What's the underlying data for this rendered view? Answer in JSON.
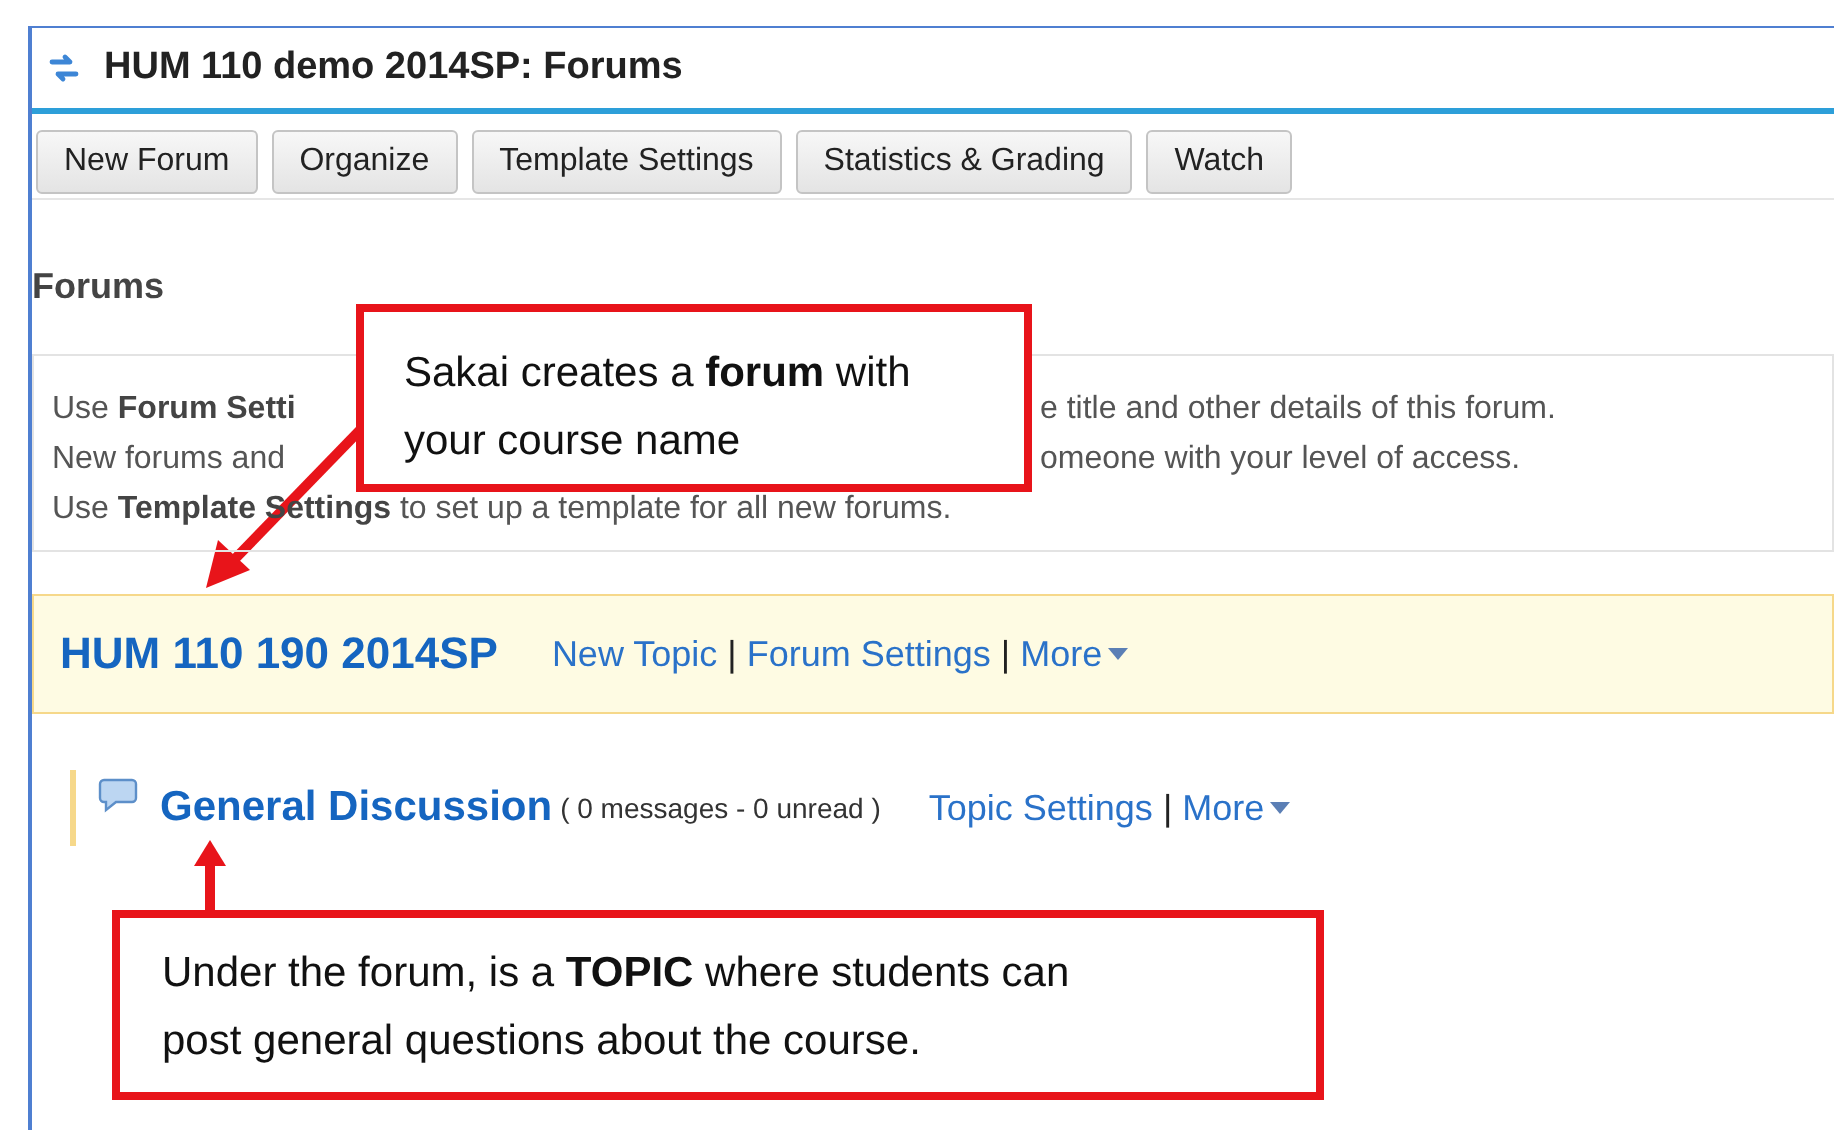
{
  "window": {
    "title": "HUM 110 demo 2014SP: Forums"
  },
  "toolbar": {
    "buttons": [
      "New Forum",
      "Organize",
      "Template Settings",
      "Statistics & Grading",
      "Watch"
    ]
  },
  "section_title": "Forums",
  "instructions": {
    "lines": [
      {
        "left": "Use **Forum Setti**",
        "right": "e title and other details of this forum."
      },
      {
        "left": "New forums and",
        "right": "omeone with your level of access."
      },
      {
        "left": "Use **Template Settings** to set up a template for all new forums."
      }
    ]
  },
  "forum": {
    "title": "HUM 110 190 2014SP",
    "links": [
      "New Topic",
      "Forum Settings"
    ],
    "separator": "|",
    "more": "More"
  },
  "topic": {
    "title": "General Discussion",
    "counts": "( 0 messages - 0 unread )",
    "links": [
      "Topic Settings"
    ],
    "separator": "|",
    "more": "More"
  },
  "callouts": [
    {
      "text": "Sakai creates a **forum** with your course name"
    },
    {
      "text": "Under the forum, is a **TOPIC** where students can post general questions about the course."
    }
  ]
}
